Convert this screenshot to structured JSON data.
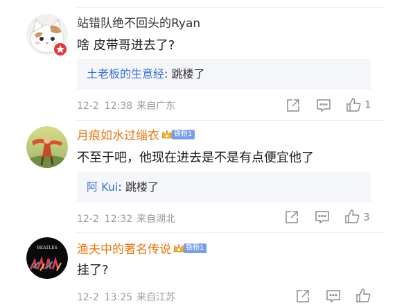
{
  "comments": [
    {
      "username": "站错队绝不回头的Ryan",
      "text": "啥 皮带哥进去了?",
      "reply_user": "土老板的生意经",
      "reply_text": " 跳楼了",
      "date": "12-2",
      "time": "12:38",
      "location": "来自广东",
      "like_count": "1",
      "avatar_icon": "cat-avatar-icon"
    },
    {
      "username": "月痕如水过缁衣",
      "fan_badge": "铁粉1",
      "text": "不至于吧，他现在进去是不是有点便宜他了",
      "reply_user": "阿 Kui",
      "reply_text": " 跳楼了",
      "date": "12-2",
      "time": "12:32",
      "location": "来自湖北",
      "like_count": "3",
      "avatar_icon": "dancer-avatar-icon"
    },
    {
      "username": "渔夫中的著名传说",
      "fan_badge": "铁粉1",
      "text": "挂了?",
      "date": "12-2",
      "time": "13:25",
      "location": "来自江苏",
      "like_count": "",
      "avatar_icon": "beatles-avatar-icon",
      "avatar_text": "BEATLES"
    }
  ],
  "colors": {
    "reply_name": "#3c72d8",
    "vip_name": "#e8760f",
    "reply_bg": "#f4f6f9",
    "meta_gray": "#9a9a9a"
  }
}
